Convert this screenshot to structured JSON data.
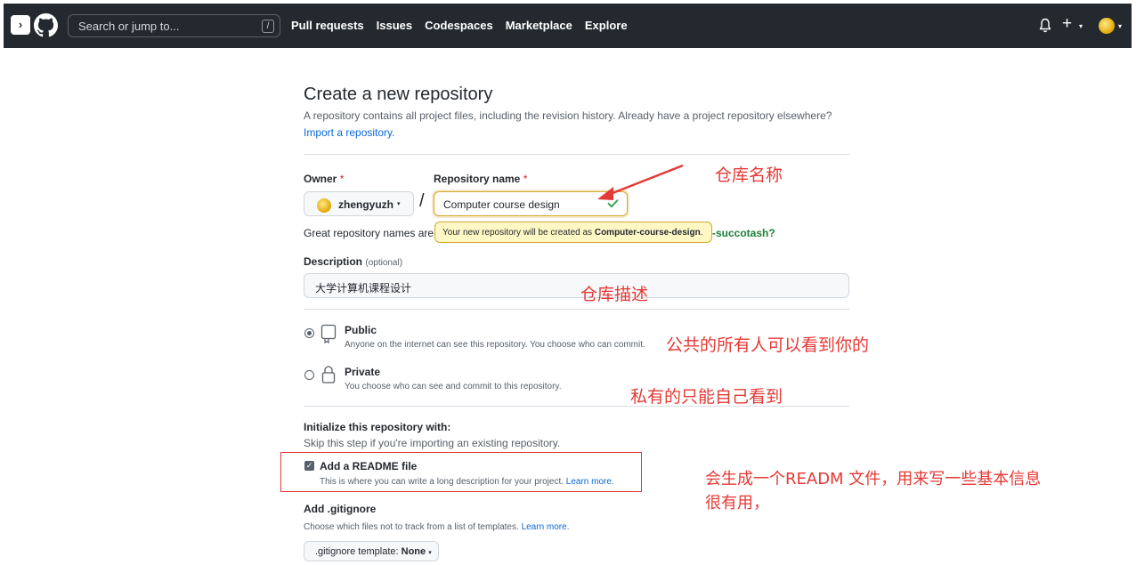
{
  "header": {
    "search_placeholder": "Search or jump to...",
    "search_key": "/",
    "nav": [
      "Pull requests",
      "Issues",
      "Codespaces",
      "Marketplace",
      "Explore"
    ],
    "plus": "+",
    "caret": "▾",
    "icons": [
      "sidebar-toggle-icon",
      "github-logo-icon",
      "bell-icon",
      "plus-icon",
      "avatar"
    ]
  },
  "page": {
    "title": "Create a new repository",
    "subtitle": "A repository contains all project files, including the revision history. Already have a project repository elsewhere?",
    "import_link": "Import a repository."
  },
  "form": {
    "owner_label": "Owner",
    "required_mark": "*",
    "owner_value": "zhengyuzh",
    "slash": "/",
    "repo_label": "Repository name",
    "repo_value": "Computer course design",
    "great_prefix": "Great repository names are",
    "great_suffix": "-succotash?",
    "tooltip_prefix": "Your new repository will be created as ",
    "tooltip_name": "Computer-course-design",
    "tooltip_end": ".",
    "desc_label": "Description",
    "desc_optional": "(optional)",
    "desc_value": "大学计算机课程设计",
    "public_title": "Public",
    "public_desc": "Anyone on the internet can see this repository. You choose who can commit.",
    "private_title": "Private",
    "private_desc": "You choose who can see and commit to this repository.",
    "init_title": "Initialize this repository with:",
    "init_sub": "Skip this step if you're importing an existing repository.",
    "readme_title": "Add a README file",
    "readme_desc": "This is where you can write a long description for your project.",
    "learn_more": "Learn more.",
    "gitignore_title": "Add .gitignore",
    "gitignore_desc": "Choose which files not to track from a list of templates.",
    "gitignore_btn_prefix": ".gitignore template:",
    "gitignore_btn_value": "None",
    "checkmark": "✓"
  },
  "annotations": {
    "repo_name": "仓库名称",
    "description": "仓库描述",
    "public": "公共的所有人可以看到你的",
    "private": "私有的只能自己看到",
    "readme_line1": "会生成一个READM 文件，用来写一些基本信息",
    "readme_line2": "很有用，"
  },
  "colors": {
    "header_bg": "#24292f",
    "annotation": "#e53935",
    "link": "#0969da",
    "success": "#1a7f37",
    "tooltip_bg": "#fff8c5"
  }
}
